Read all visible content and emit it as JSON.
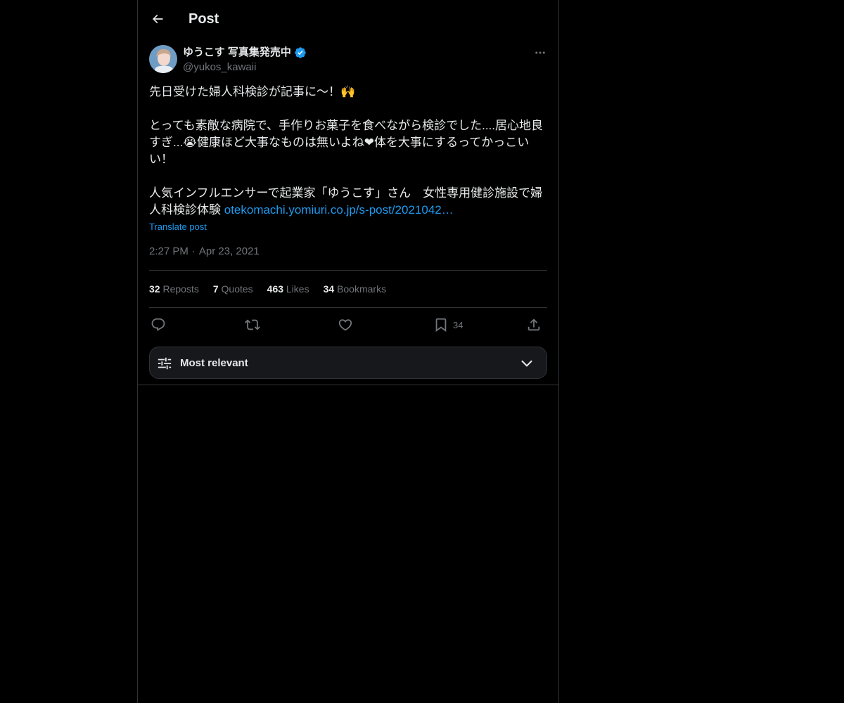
{
  "header": {
    "back_icon": "arrow-left-icon",
    "title": "Post"
  },
  "author": {
    "display_name": "ゆうこす 写真集発売中",
    "handle": "@yukos_kawaii",
    "verified": true,
    "verified_color": "#1d9bf0"
  },
  "tweet": {
    "line1": "先日受けた婦人科検診が記事に〜！🙌",
    "line2": "とっても素敵な病院で、手作りお菓子を食べながら検診でした....居心地良すぎ...😭健康ほど大事なものは無いよね❤体を大事にするってかっこいい！",
    "line3": "人気インフルエンサーで起業家「ゆうこす」さん　女性専用健診施設で婦人科検診体験 ",
    "link_text": "otekomachi.yomiuri.co.jp/s-post/2021042…",
    "translate_label": "Translate post",
    "time": "2:27 PM",
    "separator": "·",
    "date": "Apr 23, 2021"
  },
  "stats": [
    {
      "count": "32",
      "label": "Reposts"
    },
    {
      "count": "7",
      "label": "Quotes"
    },
    {
      "count": "463",
      "label": "Likes"
    },
    {
      "count": "34",
      "label": "Bookmarks"
    }
  ],
  "actions": {
    "reply_icon": "reply-icon",
    "repost_icon": "repost-icon",
    "like_icon": "heart-icon",
    "bookmark_icon": "bookmark-icon",
    "bookmark_count": "34",
    "share_icon": "share-icon"
  },
  "sort": {
    "label": "Most relevant",
    "icon": "sliders-icon",
    "chevron": "chevron-down-icon"
  },
  "colors": {
    "background": "#000000",
    "text": "#e7e9ea",
    "muted": "#71767b",
    "accent": "#1d9bf0",
    "border": "#2f3336"
  }
}
